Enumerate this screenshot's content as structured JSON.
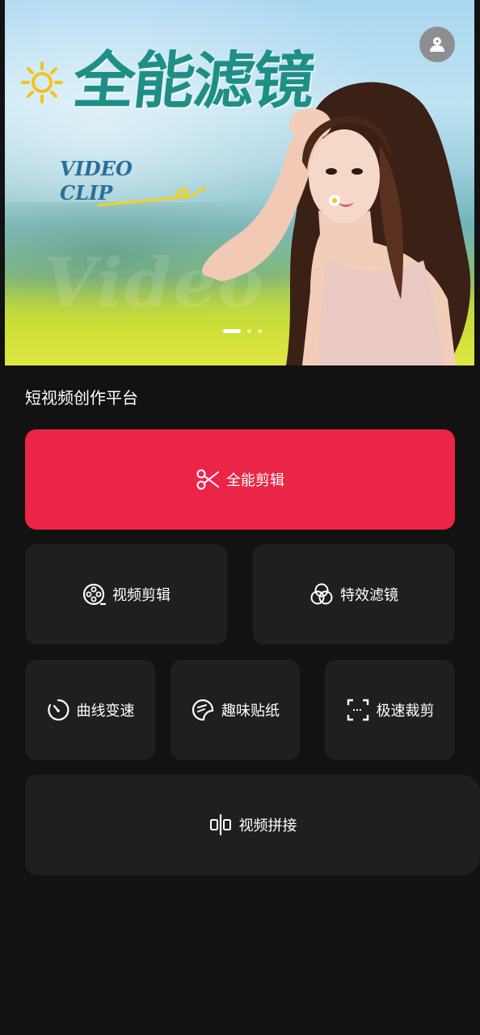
{
  "banner": {
    "headline": "全能滤镜",
    "subtitle_line1": "VIDEO",
    "subtitle_line2": "CLIP",
    "watermark": "Video",
    "carousel": {
      "count": 3,
      "active": 0
    }
  },
  "profile": {
    "icon": "user-icon"
  },
  "section": {
    "title": "短视频创作平台"
  },
  "actions": {
    "all_edit": {
      "label": "全能剪辑",
      "icon": "scissors-icon",
      "color": "#eb2547"
    },
    "video_edit": {
      "label": "视频剪辑",
      "icon": "film-reel-icon"
    },
    "effects_filter": {
      "label": "特效滤镜",
      "icon": "color-circles-icon"
    },
    "curve_speed": {
      "label": "曲线变速",
      "icon": "stopwatch-icon"
    },
    "fun_sticker": {
      "label": "趣味贴纸",
      "icon": "sticker-icon"
    },
    "quick_crop": {
      "label": "极速裁剪",
      "icon": "crop-frame-icon"
    },
    "video_join": {
      "label": "视频拼接",
      "icon": "split-join-icon"
    }
  },
  "colors": {
    "background": "#121212",
    "tile": "#1f1f1f",
    "accent": "#eb2547",
    "headline": "#1f8f86"
  }
}
